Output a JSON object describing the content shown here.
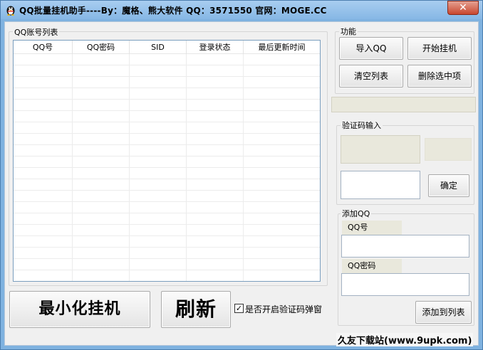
{
  "window": {
    "title": "QQ批量挂机助手----By：魔格、熊大软件 QQ：3571550 官网：MOGE.CC",
    "close_label": "✕"
  },
  "account_list": {
    "label": "QQ账号列表",
    "columns": [
      "QQ号",
      "QQ密码",
      "SID",
      "登录状态",
      "最后更新时间"
    ],
    "rows": []
  },
  "functions": {
    "label": "功能",
    "import_label": "导入QQ",
    "start_label": "开始挂机",
    "clear_label": "清空列表",
    "delete_label": "删除选中项"
  },
  "captcha": {
    "label": "验证码输入",
    "confirm_label": "确定"
  },
  "add_qq": {
    "label": "添加QQ",
    "qq_label": "QQ号",
    "password_label": "QQ密码",
    "add_label": "添加到列表"
  },
  "bottom": {
    "minimize_label": "最小化挂机",
    "refresh_label": "刷新",
    "captcha_popup_label": "是否开启验证码弹窗",
    "captcha_popup_checked": true
  },
  "watermark": "久友下载站(www.9upk.com)"
}
